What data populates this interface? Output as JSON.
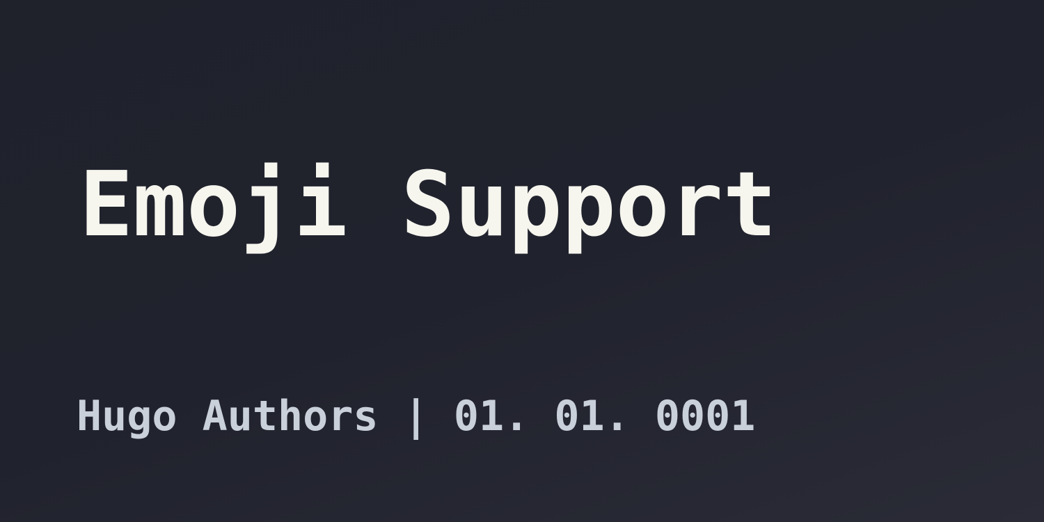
{
  "title": "Emoji Support",
  "byline": {
    "author": "Hugo Authors",
    "separator": "|",
    "date": "01. 01. 0001"
  }
}
